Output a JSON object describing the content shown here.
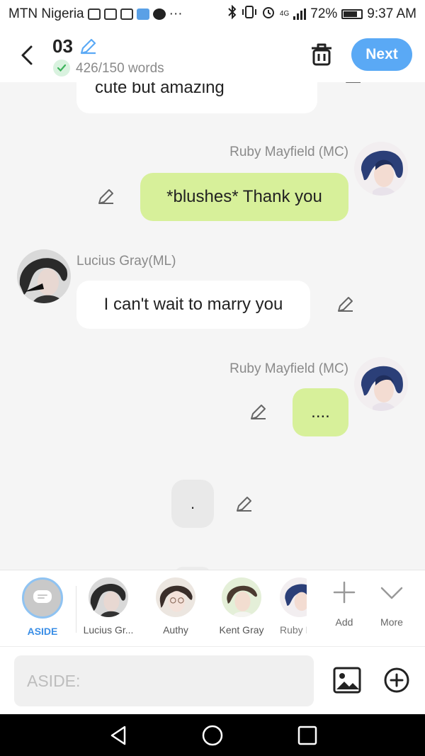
{
  "status_bar": {
    "carrier": "MTN Nigeria",
    "more_indicator": "···",
    "network": "4G",
    "battery": "72%",
    "time": "9:37 AM"
  },
  "header": {
    "title": "03",
    "word_count": "426/150 words",
    "next_label": "Next",
    "accent_color": "#5aa9f5"
  },
  "messages": [
    {
      "type": "narration",
      "text": "cute but amazing"
    },
    {
      "type": "mc",
      "sender": "Ruby Mayfield (MC)",
      "text": "*blushes* Thank you"
    },
    {
      "type": "ml",
      "sender": "Lucius Gray(ML)",
      "text": "I can't wait to marry you"
    },
    {
      "type": "mc",
      "sender": "Ruby Mayfield (MC)",
      "text": "...."
    },
    {
      "type": "aside",
      "text": "."
    }
  ],
  "characters": {
    "aside_label": "ASIDE",
    "items": [
      {
        "label": "Lucius Gr..."
      },
      {
        "label": "Authy"
      },
      {
        "label": "Kent Gray"
      },
      {
        "label": "Ruby M"
      }
    ],
    "add_label": "Add",
    "more_label": "More"
  },
  "input": {
    "placeholder": "ASIDE:"
  },
  "colors": {
    "mc_bubble": "#d7f09a",
    "ml_bubble": "#ffffff",
    "aside_bubble": "#e9e9e9"
  }
}
